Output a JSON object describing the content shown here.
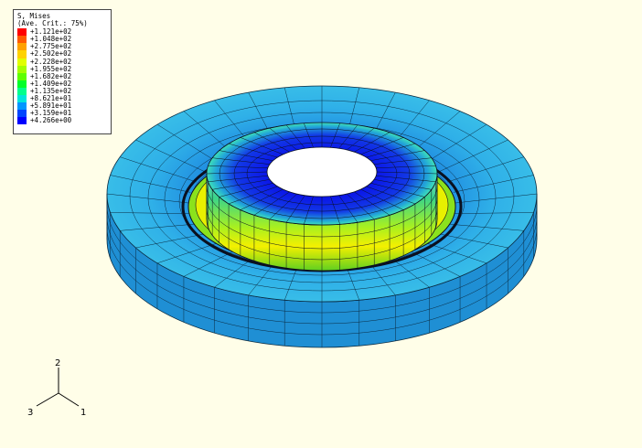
{
  "legend": {
    "title_line1": "S, Mises",
    "title_line2": "(Ave. Crit.: 75%)",
    "entries": [
      {
        "value": "+1.121e+02",
        "color": "#ff0000"
      },
      {
        "value": "+1.048e+02",
        "color": "#ff5a00"
      },
      {
        "value": "+2.775e+02",
        "color": "#ffa100"
      },
      {
        "value": "+2.502e+02",
        "color": "#ffd200"
      },
      {
        "value": "+2.228e+02",
        "color": "#e1ff00"
      },
      {
        "value": "+1.955e+02",
        "color": "#a4ff00"
      },
      {
        "value": "+1.682e+02",
        "color": "#5fff00"
      },
      {
        "value": "+1.409e+02",
        "color": "#00ff2a"
      },
      {
        "value": "+1.135e+02",
        "color": "#00ff8c"
      },
      {
        "value": "+8.621e+01",
        "color": "#00e6dc"
      },
      {
        "value": "+5.891e+01",
        "color": "#0096ff"
      },
      {
        "value": "+3.159e+01",
        "color": "#0046ff"
      },
      {
        "value": "+4.266e+00",
        "color": "#0000ff"
      }
    ]
  },
  "triad": {
    "axis_2": "2",
    "axis_3": "3",
    "axis_1": "1"
  },
  "colors": {
    "background": "#fffee8",
    "flange_outer": "#2faee6",
    "flange_band": "#1c78d2",
    "hub_inner": "#0f3bd8",
    "hub_wall": "#7fe01c",
    "hub_band": "#f0f000",
    "hub_top_ring": "#2fd0b4"
  }
}
